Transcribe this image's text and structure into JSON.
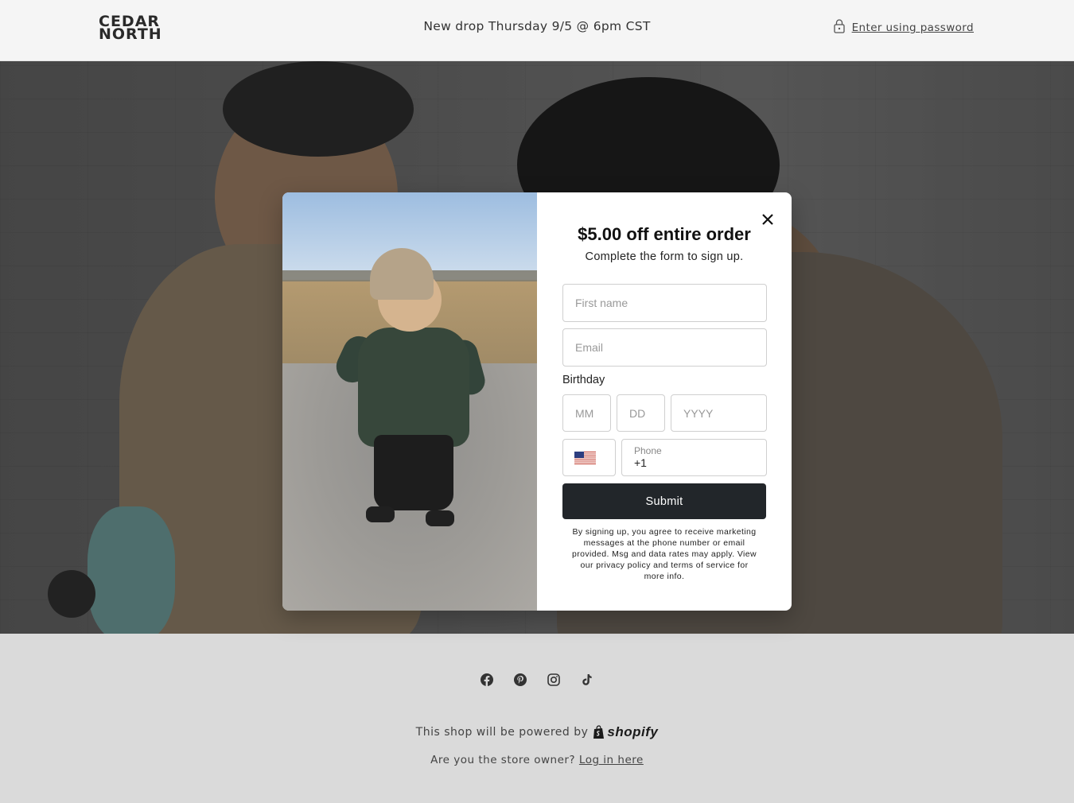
{
  "header": {
    "logo_line1": "CEDAR",
    "logo_line2": "NORTH",
    "announcement": "New drop Thursday 9/5 @ 6pm CST",
    "password_link": "Enter using password"
  },
  "popup": {
    "title": "$5.00 off entire order",
    "subtitle": "Complete the form to sign up.",
    "first_name_placeholder": "First name",
    "email_placeholder": "Email",
    "birthday_label": "Birthday",
    "month_placeholder": "MM",
    "day_placeholder": "DD",
    "year_placeholder": "YYYY",
    "country_flag": "us-flag-icon",
    "phone_label": "Phone",
    "phone_value": "+1",
    "submit_label": "Submit",
    "legal_text": "By signing up, you agree to receive marketing messages at the phone number or email provided. Msg and data rates may apply. View our privacy policy and terms of service for more info."
  },
  "footer": {
    "socials": [
      "facebook-icon",
      "pinterest-icon",
      "instagram-icon",
      "tiktok-icon"
    ],
    "powered_text": "This shop will be powered by",
    "shopify_label": "shopify",
    "owner_text": "Are you the store owner?",
    "login_link": "Log in here"
  },
  "colors": {
    "button": "#22262a",
    "header_bg": "#f5f5f5",
    "footer_bg": "#dadada"
  }
}
